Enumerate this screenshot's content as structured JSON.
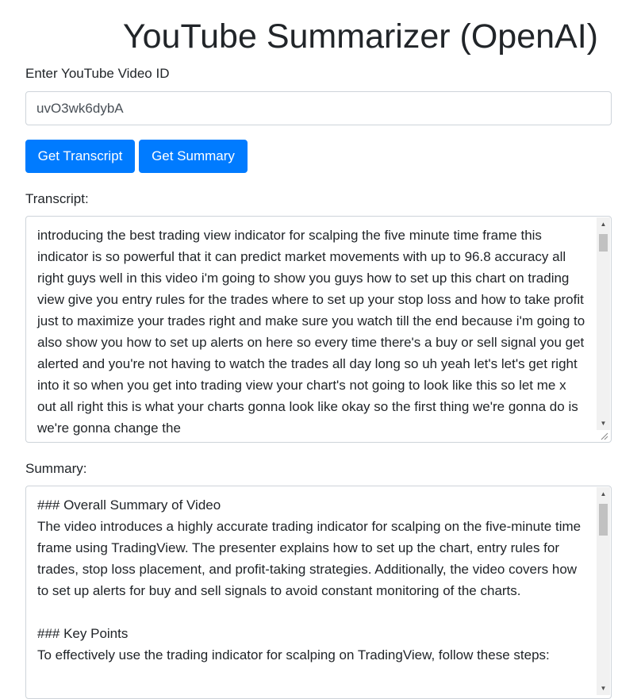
{
  "title": "YouTube Summarizer (OpenAI)",
  "video_id_label": "Enter YouTube Video ID",
  "video_id_value": "uvO3wk6dybA",
  "buttons": {
    "get_transcript": "Get Transcript",
    "get_summary": "Get Summary"
  },
  "transcript_label": "Transcript:",
  "transcript_text": "introducing the best trading view indicator for scalping the five minute time frame this indicator is so powerful that it can predict market movements with up to 96.8 accuracy all right guys well in this video i'm going to show you guys how to set up this chart on trading view give you entry rules for the trades where to set up your stop loss and how to take profit just to maximize your trades right and make sure you watch till the end because i'm going to also show you how to set up alerts on here so every time there's a buy or sell signal you get alerted and you're not having to watch the trades all day long so uh yeah let's let's get right into it so when you get into trading view your chart's not going to look like this so let me x out all right this is what your charts gonna look like okay so the first thing we're gonna do is we're gonna change the",
  "summary_label": "Summary:",
  "summary_text": "### Overall Summary of Video\nThe video introduces a highly accurate trading indicator for scalping on the five-minute time frame using TradingView. The presenter explains how to set up the chart, entry rules for trades, stop loss placement, and profit-taking strategies. Additionally, the video covers how to set up alerts for buy and sell signals to avoid constant monitoring of the charts.\n\n### Key Points\nTo effectively use the trading indicator for scalping on TradingView, follow these steps:",
  "colors": {
    "primary": "#007bff",
    "border": "#ced4da",
    "text": "#212529"
  }
}
